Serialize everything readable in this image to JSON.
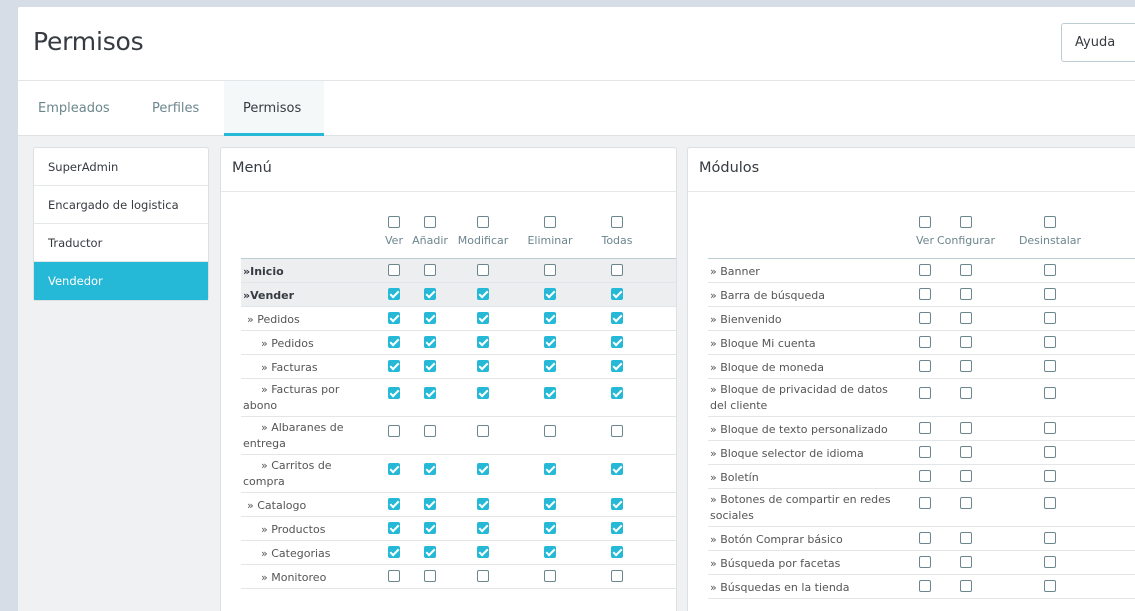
{
  "header": {
    "title": "Permisos",
    "help_label": "Ayuda"
  },
  "tabs": [
    {
      "label": "Empleados",
      "active": false
    },
    {
      "label": "Perfiles",
      "active": false
    },
    {
      "label": "Permisos",
      "active": true
    }
  ],
  "profiles": [
    {
      "label": "SuperAdmin",
      "active": false
    },
    {
      "label": "Encargado de logistica",
      "active": false
    },
    {
      "label": "Traductor",
      "active": false
    },
    {
      "label": "Vendedor",
      "active": true
    }
  ],
  "menu_panel": {
    "title": "Menú",
    "columns": [
      "Ver",
      "Añadir",
      "Modificar",
      "Eliminar",
      "Todas"
    ],
    "rows": [
      {
        "label": "»Inicio",
        "bold": true,
        "indent": 0,
        "checked": [
          false,
          false,
          false,
          false,
          false
        ]
      },
      {
        "label": "»Vender",
        "bold": true,
        "indent": 0,
        "checked": [
          true,
          true,
          true,
          true,
          true
        ]
      },
      {
        "label": "» Pedidos",
        "bold": false,
        "indent": 1,
        "checked": [
          true,
          true,
          true,
          true,
          true
        ]
      },
      {
        "label": "» Pedidos",
        "bold": false,
        "indent": 2,
        "checked": [
          true,
          true,
          true,
          true,
          true
        ]
      },
      {
        "label": "» Facturas",
        "bold": false,
        "indent": 2,
        "checked": [
          true,
          true,
          true,
          true,
          true
        ]
      },
      {
        "label": "» Facturas por abono",
        "bold": false,
        "indent": 2,
        "checked": [
          true,
          true,
          true,
          true,
          true
        ]
      },
      {
        "label": "» Albaranes de entrega",
        "bold": false,
        "indent": 2,
        "checked": [
          false,
          false,
          false,
          false,
          false
        ]
      },
      {
        "label": "» Carritos de compra",
        "bold": false,
        "indent": 2,
        "checked": [
          true,
          true,
          true,
          true,
          true
        ]
      },
      {
        "label": "» Catalogo",
        "bold": false,
        "indent": 1,
        "checked": [
          true,
          true,
          true,
          true,
          true
        ]
      },
      {
        "label": "» Productos",
        "bold": false,
        "indent": 2,
        "checked": [
          true,
          true,
          true,
          true,
          true
        ]
      },
      {
        "label": "» Categorias",
        "bold": false,
        "indent": 2,
        "checked": [
          true,
          true,
          true,
          true,
          true
        ]
      },
      {
        "label": "» Monitoreo",
        "bold": false,
        "indent": 2,
        "checked": [
          false,
          false,
          false,
          false,
          false
        ]
      }
    ]
  },
  "modules_panel": {
    "title": "Módulos",
    "columns": [
      "Ver",
      "Configurar",
      "Desinstalar"
    ],
    "rows": [
      {
        "label": "» Banner",
        "checked": [
          false,
          false,
          false
        ]
      },
      {
        "label": "» Barra de búsqueda",
        "checked": [
          false,
          false,
          false
        ]
      },
      {
        "label": "» Bienvenido",
        "checked": [
          false,
          false,
          false
        ]
      },
      {
        "label": "» Bloque Mi cuenta",
        "checked": [
          false,
          false,
          false
        ]
      },
      {
        "label": "» Bloque de moneda",
        "checked": [
          false,
          false,
          false
        ]
      },
      {
        "label": "» Bloque de privacidad de datos del cliente",
        "checked": [
          false,
          false,
          false
        ]
      },
      {
        "label": "» Bloque de texto personalizado",
        "checked": [
          false,
          false,
          false
        ]
      },
      {
        "label": "» Bloque selector de idioma",
        "checked": [
          false,
          false,
          false
        ]
      },
      {
        "label": "» Boletín",
        "checked": [
          false,
          false,
          false
        ]
      },
      {
        "label": "» Botones de compartir en redes sociales",
        "checked": [
          false,
          false,
          false
        ]
      },
      {
        "label": "» Botón Comprar básico",
        "checked": [
          false,
          false,
          false
        ]
      },
      {
        "label": "» Búsqueda por facetas",
        "checked": [
          false,
          false,
          false
        ]
      },
      {
        "label": "» Búsquedas en la tienda",
        "checked": [
          false,
          false,
          false
        ]
      }
    ]
  },
  "colors": {
    "accent": "#25b9d7",
    "text": "#363a41",
    "muted": "#6c868e"
  }
}
